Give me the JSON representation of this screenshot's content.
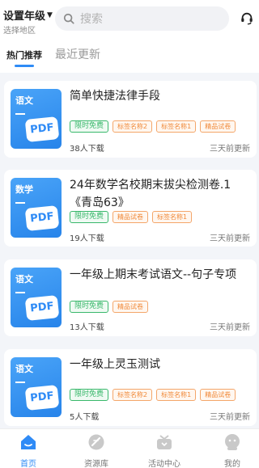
{
  "header": {
    "grade_label": "设置年级",
    "region_label": "选择地区",
    "search_placeholder": "搜索"
  },
  "tabs": [
    {
      "label": "热门推荐",
      "active": true
    },
    {
      "label": "最近更新",
      "active": false
    }
  ],
  "cards": [
    {
      "subject": "语文",
      "cover_badge": "PDF",
      "title": "简单快捷法律手段",
      "tags": [
        "限时免费",
        "标签名称2",
        "标签名称1",
        "精品试卷"
      ],
      "downloads": "38人下载",
      "updated": "三天前更新"
    },
    {
      "subject": "数学",
      "cover_badge": "PDF",
      "title": "24年数学名校期末拔尖检测卷.1《青岛63》",
      "tags": [
        "限时免费",
        "精品试卷",
        "标签名称1"
      ],
      "downloads": "19人下载",
      "updated": "三天前更新"
    },
    {
      "subject": "语文",
      "cover_badge": "PDF",
      "title": "一年级上期末考试语文--句子专项",
      "tags": [
        "限时免费",
        "精品试卷"
      ],
      "downloads": "13人下载",
      "updated": "三天前更新"
    },
    {
      "subject": "语文",
      "cover_badge": "PDF",
      "title": "一年级上灵玉测试",
      "tags": [
        "限时免费",
        "标签名称2",
        "标签名称1",
        "精品试卷"
      ],
      "downloads": "5人下载",
      "updated": "三天前更新"
    }
  ],
  "tabbar": [
    {
      "label": "首页",
      "icon": "home-icon",
      "active": true
    },
    {
      "label": "资源库",
      "icon": "resource-library-icon",
      "active": false
    },
    {
      "label": "活动中心",
      "icon": "activity-center-icon",
      "active": false
    },
    {
      "label": "我的",
      "icon": "profile-icon",
      "active": false
    }
  ],
  "colors": {
    "accent": "#2f8bf6",
    "free_tag": "#39b86b",
    "label_tag": "#f08a3a",
    "background": "#f3f5f9"
  }
}
